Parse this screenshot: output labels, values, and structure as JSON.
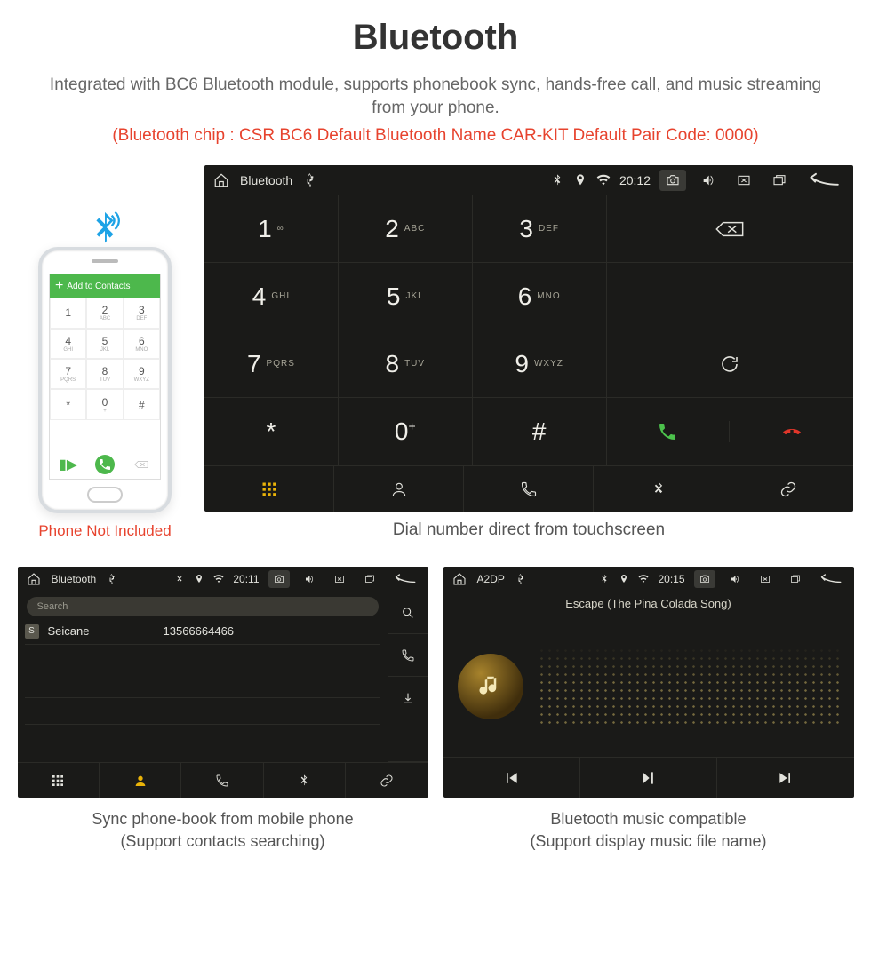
{
  "title": "Bluetooth",
  "description": "Integrated with BC6 Bluetooth module, supports phonebook sync, hands-free call, and music streaming from your phone.",
  "specs": "(Bluetooth chip : CSR BC6    Default Bluetooth Name CAR-KIT    Default Pair Code: 0000)",
  "phone": {
    "bar_label": "Add to Contacts",
    "keys": [
      {
        "n": "1",
        "s": ""
      },
      {
        "n": "2",
        "s": "ABC"
      },
      {
        "n": "3",
        "s": "DEF"
      },
      {
        "n": "4",
        "s": "GHI"
      },
      {
        "n": "5",
        "s": "JKL"
      },
      {
        "n": "6",
        "s": "MNO"
      },
      {
        "n": "7",
        "s": "PQRS"
      },
      {
        "n": "8",
        "s": "TUV"
      },
      {
        "n": "9",
        "s": "WXYZ"
      },
      {
        "n": "*",
        "s": ""
      },
      {
        "n": "0",
        "s": "+"
      },
      {
        "n": "#",
        "s": ""
      }
    ],
    "caption": "Phone Not Included"
  },
  "dialer": {
    "status": {
      "title": "Bluetooth",
      "time": "20:12"
    },
    "keys": [
      {
        "n": "1",
        "s": "∞"
      },
      {
        "n": "2",
        "s": "ABC"
      },
      {
        "n": "3",
        "s": "DEF"
      },
      {
        "n": "4",
        "s": "GHI"
      },
      {
        "n": "5",
        "s": "JKL"
      },
      {
        "n": "6",
        "s": "MNO"
      },
      {
        "n": "7",
        "s": "PQRS"
      },
      {
        "n": "8",
        "s": "TUV"
      },
      {
        "n": "9",
        "s": "WXYZ"
      },
      {
        "n": "*",
        "s": ""
      },
      {
        "n": "0",
        "s": "+",
        "sup": "+"
      },
      {
        "n": "#",
        "s": ""
      }
    ],
    "caption": "Dial number direct from touchscreen"
  },
  "phonebook": {
    "status": {
      "title": "Bluetooth",
      "time": "20:11"
    },
    "search_placeholder": "Search",
    "entries": [
      {
        "tag": "S",
        "name": "Seicane",
        "number": "13566664466"
      }
    ],
    "caption_line1": "Sync phone-book from mobile phone",
    "caption_line2": "(Support contacts searching)"
  },
  "music": {
    "status": {
      "title": "A2DP",
      "time": "20:15"
    },
    "track": "Escape (The Pina Colada Song)",
    "caption_line1": "Bluetooth music compatible",
    "caption_line2": "(Support display music file name)"
  }
}
